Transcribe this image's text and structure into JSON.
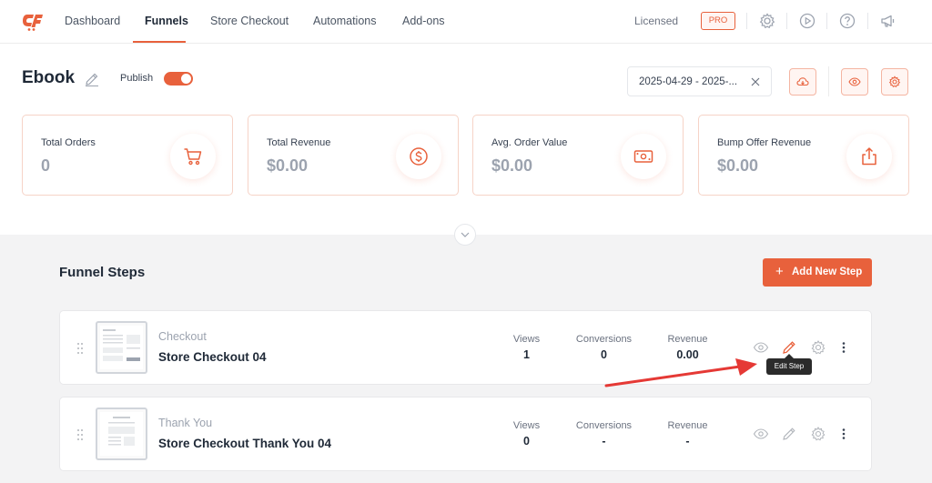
{
  "nav": {
    "items": [
      "Dashboard",
      "Funnels",
      "Store Checkout",
      "Automations",
      "Add-ons"
    ],
    "active": "Funnels",
    "license_text": "Licensed",
    "pro_badge": "PRO",
    "icons": [
      "gear-icon",
      "play-icon",
      "help-icon",
      "megaphone-icon"
    ]
  },
  "header": {
    "title": "Ebook",
    "publish_label": "Publish",
    "publish_on": true,
    "date_range": "2025-04-29 - 2025-...",
    "actions": [
      "cloud-download-icon",
      "eye-icon",
      "gear-icon"
    ]
  },
  "stats": [
    {
      "label": "Total Orders",
      "value": "0",
      "icon": "cart-icon"
    },
    {
      "label": "Total Revenue",
      "value": "$0.00",
      "icon": "dollar-circle-icon"
    },
    {
      "label": "Avg. Order Value",
      "value": "$0.00",
      "icon": "cash-icon"
    },
    {
      "label": "Bump Offer Revenue",
      "value": "$0.00",
      "icon": "share-icon"
    }
  ],
  "steps": {
    "title": "Funnel Steps",
    "add_button": "Add New Step",
    "metric_labels": {
      "views": "Views",
      "conversions": "Conversions",
      "revenue": "Revenue"
    },
    "items": [
      {
        "type": "Checkout",
        "name": "Store Checkout 04",
        "views": "1",
        "conversions": "0",
        "revenue": "0.00"
      },
      {
        "type": "Thank You",
        "name": "Store Checkout Thank You 04",
        "views": "0",
        "conversions": "-",
        "revenue": "-"
      }
    ],
    "tooltip": "Edit Step"
  },
  "colors": {
    "accent": "#e8613c",
    "annotation_arrow": "#e53935"
  }
}
